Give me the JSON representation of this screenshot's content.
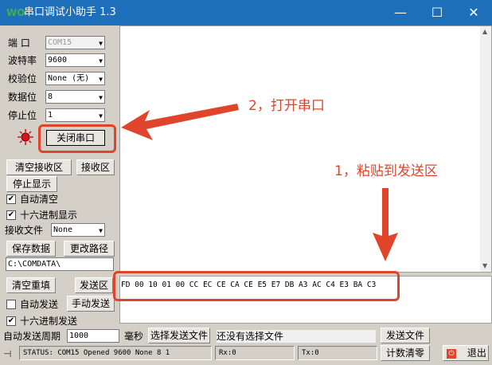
{
  "window": {
    "title": "串口调试小助手 1.3",
    "app_icon": "app-logo-icon"
  },
  "settings": {
    "port_label": "端 口",
    "port_value": "COM15",
    "baud_label": "波特率",
    "baud_value": "9600",
    "parity_label": "校验位",
    "parity_value": "None (无)",
    "databits_label": "数据位",
    "databits_value": "8",
    "stopbits_label": "停止位",
    "stopbits_value": "1",
    "toggle_port_label": "关闭串口"
  },
  "receive": {
    "clear_label": "清空接收区",
    "area_label": "接收区",
    "stop_display_label": "停止显示",
    "auto_clear_label": "自动清空",
    "auto_clear_checked": true,
    "hex_display_label": "十六进制显示",
    "hex_display_checked": true,
    "file_label": "接收文件",
    "file_value": "None",
    "save_data_label": "保存数据",
    "change_path_label": "更改路径",
    "path": "C:\\COMDATA\\"
  },
  "send": {
    "clear_label": "清空重填",
    "area_label": "发送区",
    "auto_send_label": "自动发送",
    "auto_send_checked": false,
    "manual_send_label": "手动发送",
    "hex_send_label": "十六进制发送",
    "hex_send_checked": true,
    "period_label": "自动发送周期",
    "period_value": "1000",
    "ms_label": "毫秒",
    "choose_file_label": "选择发送文件",
    "file_status": "还没有选择文件",
    "send_file_label": "发送文件",
    "content": "FD 00 10 01 00 CC EC CE CA CE E5 E7 DB A3 AC C4 E3 BA C3"
  },
  "status": {
    "text": "STATUS: COM15 Opened 9600 None  8 1",
    "rx": "Rx:0",
    "tx": "Tx:0",
    "reset_count_label": "计数清零",
    "exit_label": "退出"
  },
  "annotations": {
    "step2": "2，打开串口",
    "step1": "1，粘贴到发送区"
  },
  "colors": {
    "accent_red": "#e0452c",
    "titlebar": "#1e6fb9",
    "led": "#e01020"
  }
}
